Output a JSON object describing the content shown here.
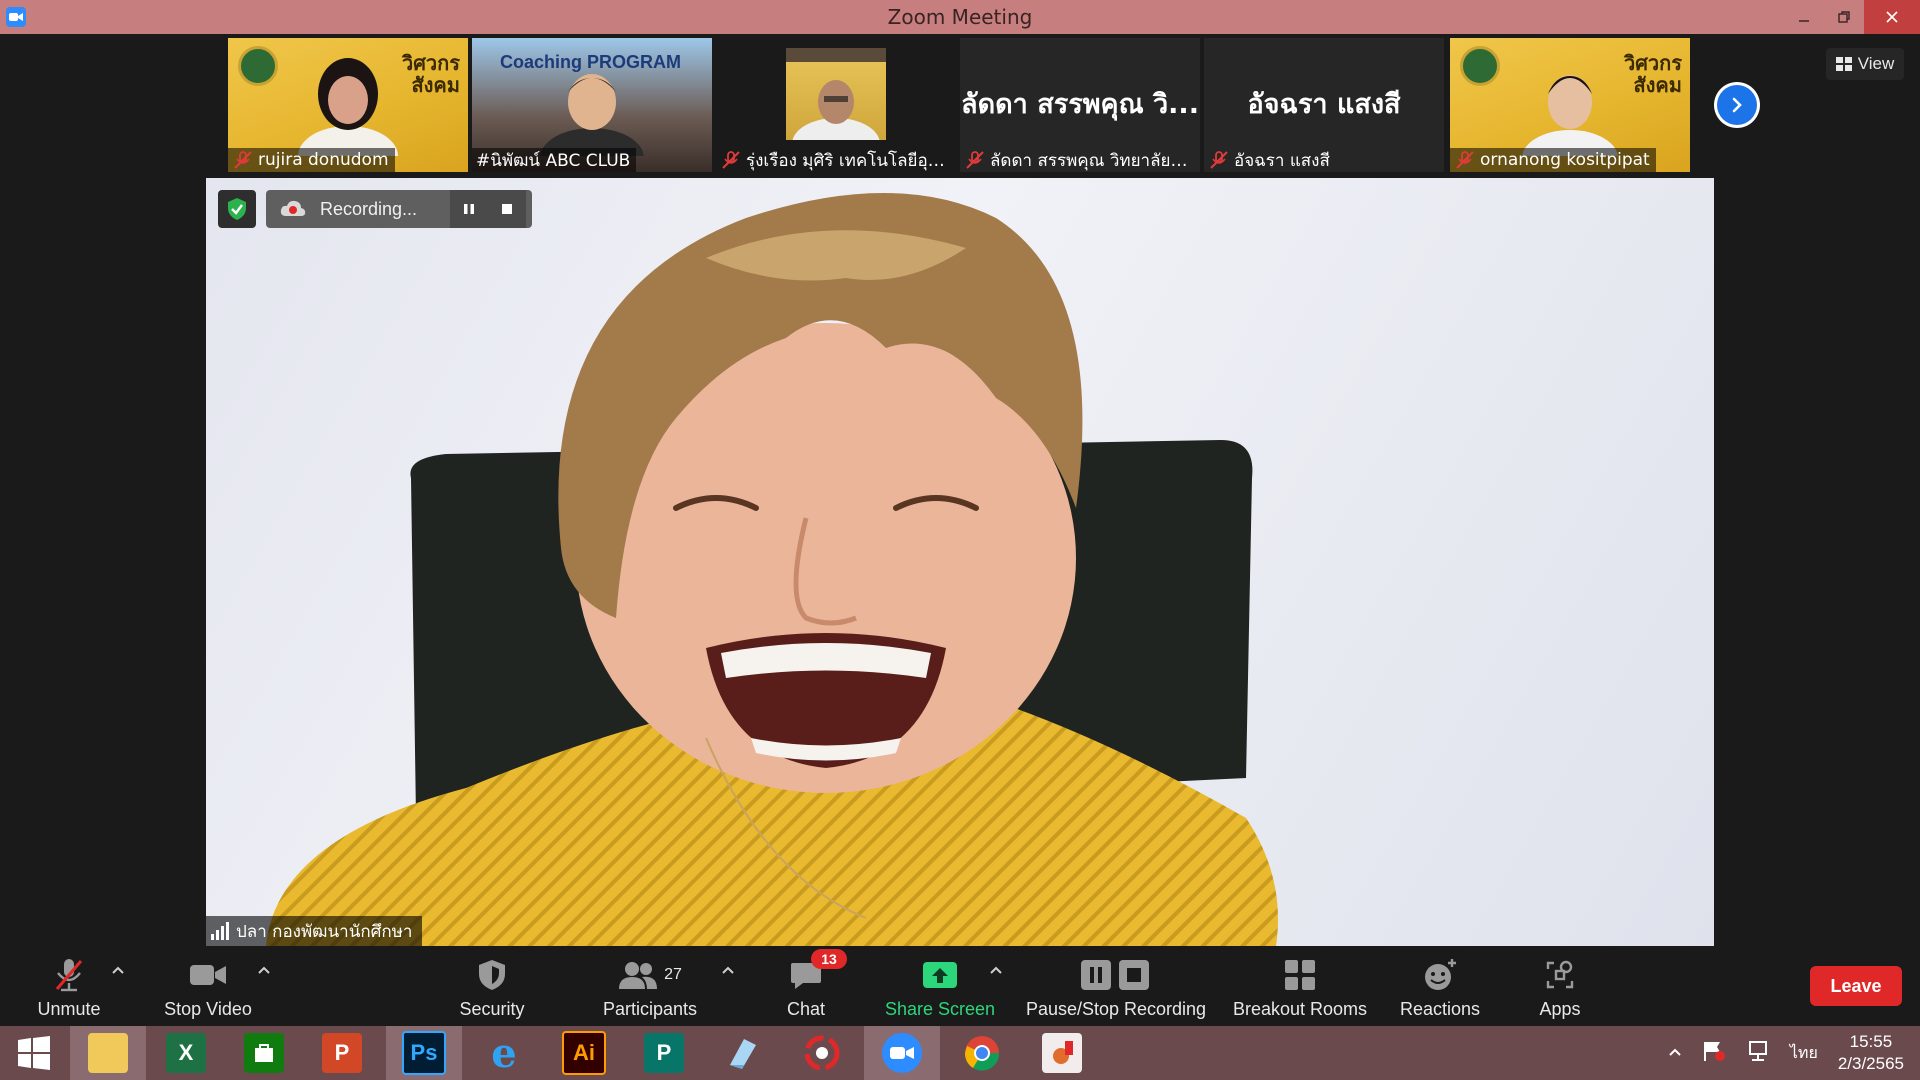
{
  "window": {
    "title": "Zoom Meeting"
  },
  "gallery": {
    "tiles": [
      {
        "name": "rujira donudom",
        "banner": "วิศวกร\nสังคม",
        "style": "photo"
      },
      {
        "name": "#นิพัฒน์ ABC CLUB",
        "banner": "Coaching PROGRAM",
        "style": "coach"
      },
      {
        "name": "รุ่งเรือง มุศิริ เทคโนโลยีอุตสา...",
        "style": "small"
      },
      {
        "name": "ลัดดา สรรพคุณ วิทยาลัยกา...",
        "display_name": "ลัดดา สรรพคุณ วิ...",
        "style": "dark"
      },
      {
        "name": "อัจฉรา แสงสี",
        "display_name": "อัจฉรา แสงสี",
        "style": "dark"
      },
      {
        "name": "ornanong kositpipat",
        "banner": "วิศวกร\nสังคม",
        "style": "photo"
      }
    ],
    "view_label": "View"
  },
  "main": {
    "recording_label": "Recording...",
    "speaker_name": "ปลา กองพัฒนานักศึกษา"
  },
  "toolbar": {
    "unmute": "Unmute",
    "stop_video": "Stop Video",
    "security": "Security",
    "participants": "Participants",
    "participants_count": "27",
    "chat": "Chat",
    "chat_badge": "13",
    "share_screen": "Share Screen",
    "pause_stop_recording": "Pause/Stop Recording",
    "breakout_rooms": "Breakout Rooms",
    "reactions": "Reactions",
    "apps": "Apps",
    "leave": "Leave"
  },
  "taskbar": {
    "apps": [
      "start",
      "file-explorer",
      "excel",
      "store",
      "powerpoint",
      "photoshop",
      "internet-explorer",
      "illustrator",
      "publisher",
      "app",
      "photoscape",
      "zoom",
      "chrome",
      "paint"
    ],
    "language": "ไทย",
    "time": "15:55",
    "date": "2/3/2565"
  },
  "colors": {
    "accent": "#2d8cff",
    "leave": "#e02828",
    "share": "#2cd67a",
    "titlebar": "#c77e7e"
  }
}
